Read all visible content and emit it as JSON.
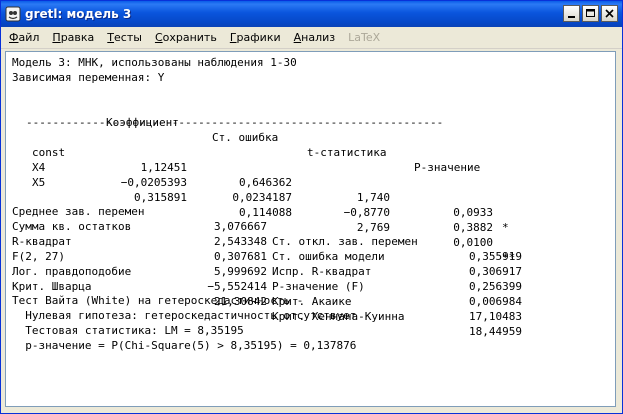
{
  "window": {
    "title": "gretl: модель 3",
    "buttons": {
      "minimize": "minimize",
      "maximize": "maximize",
      "close": "close"
    }
  },
  "menu": [
    {
      "u": "Ф",
      "rest": "айл"
    },
    {
      "u": "П",
      "rest": "равка"
    },
    {
      "u": "Т",
      "rest": "есты"
    },
    {
      "u": "С",
      "rest": "охранить"
    },
    {
      "u": "Г",
      "rest": "рафики"
    },
    {
      "u": "А",
      "rest": "нализ"
    },
    {
      "u": "",
      "rest": "LaTeX"
    }
  ],
  "output": {
    "model_line": "Модель 3: МНК, использованы наблюдения 1-30",
    "dep_var_line": "Зависимая переменная: Y",
    "headers": {
      "coef": "Коэффициент",
      "se": "Ст. ошибка",
      "t": "t-статистика",
      "p": "P-значение"
    },
    "separator": "---------------------------------------------------------------",
    "rows": [
      {
        "name": "const",
        "coef": "1,12451",
        "se": "0,646362",
        "t": "1,740",
        "p": "0,0933",
        "stars": "*"
      },
      {
        "name": "X4",
        "coef": "−0,0205393",
        "se": "0,0234187",
        "t": "−0,8770",
        "p": "0,3882",
        "stars": ""
      },
      {
        "name": "X5",
        "coef": "0,315891",
        "se": "0,114088",
        "t": "2,769",
        "p": "0,0100",
        "stars": "**"
      }
    ],
    "stats": [
      {
        "l_label": "Среднее зав. перемен",
        "l_val": "3,076667",
        "r_label": "Ст. откл. зав. перемен",
        "r_val": "0,355919"
      },
      {
        "l_label": "Сумма кв. остатков",
        "l_val": "2,543348",
        "r_label": "Ст. ошибка модели",
        "r_val": "0,306917"
      },
      {
        "l_label": "R-квадрат",
        "l_val": "0,307681",
        "r_label": "Испр. R-квадрат",
        "r_val": "0,256399"
      },
      {
        "l_label": "F(2, 27)",
        "l_val": "5,999692",
        "r_label": "Р-значение (F)",
        "r_val": "0,006984"
      },
      {
        "l_label": "Лог. правдоподобие",
        "l_val": "−5,552414",
        "r_label": "Крит. Акаике",
        "r_val": "17,10483"
      },
      {
        "l_label": "Крит. Шварца",
        "l_val": "21,30842",
        "r_label": "Крит. Хеннана-Куинна",
        "r_val": "18,44959"
      }
    ],
    "white_test": {
      "title": "Тест Вайта (White) на гетероскедастичность -",
      "null_hyp": "  Нулевая гипотеза: гетероскедастичность отсутствует",
      "stat": "  Тестовая статистика: LM = 8,35195",
      "pval": "  p-значение = P(Chi-Square(5) > 8,35195) = 0,137876"
    }
  }
}
